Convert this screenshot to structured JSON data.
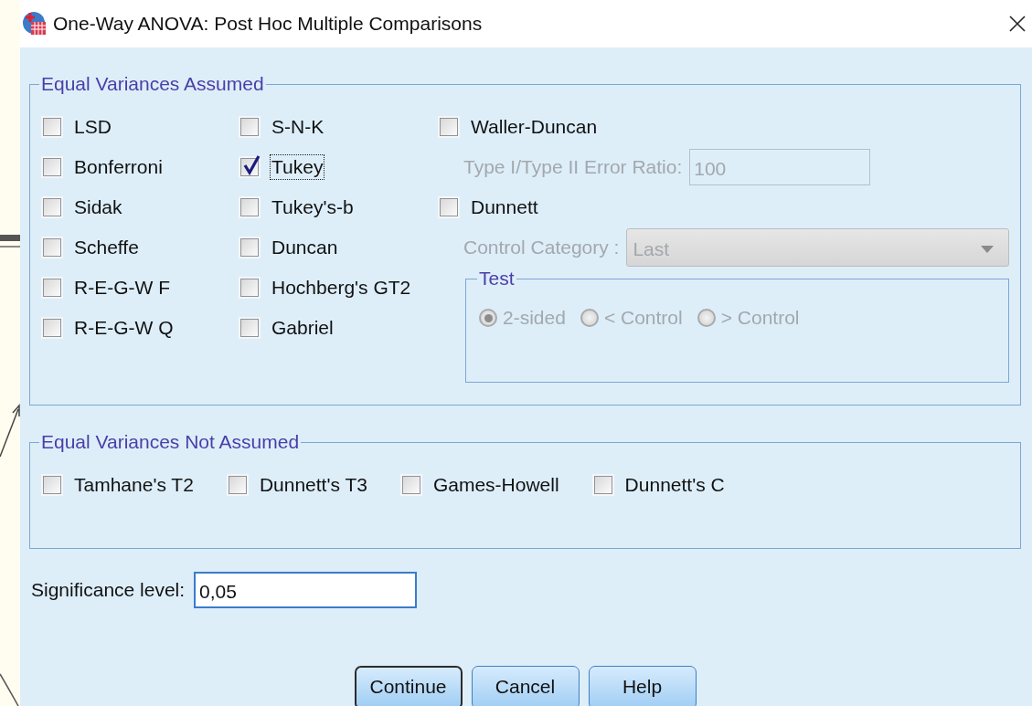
{
  "window": {
    "title": "One-Way ANOVA: Post Hoc Multiple Comparisons"
  },
  "equal_variances_assumed": {
    "title": "Equal Variances Assumed",
    "tests": [
      {
        "label": "LSD",
        "checked": false,
        "focused": false
      },
      {
        "label": "S-N-K",
        "checked": false,
        "focused": false
      },
      {
        "label": "Bonferroni",
        "checked": false,
        "focused": false
      },
      {
        "label": "Tukey",
        "checked": true,
        "focused": true
      },
      {
        "label": "Sidak",
        "checked": false,
        "focused": false
      },
      {
        "label": "Tukey's-b",
        "checked": false,
        "focused": false
      },
      {
        "label": "Scheffe",
        "checked": false,
        "focused": false
      },
      {
        "label": "Duncan",
        "checked": false,
        "focused": false
      },
      {
        "label": "R-E-G-W F",
        "checked": false,
        "focused": false
      },
      {
        "label": "Hochberg's GT2",
        "checked": false,
        "focused": false
      },
      {
        "label": "R-E-G-W Q",
        "checked": false,
        "focused": false
      },
      {
        "label": "Gabriel",
        "checked": false,
        "focused": false
      }
    ],
    "waller_duncan": {
      "label": "Waller-Duncan",
      "checked": false
    },
    "error_ratio": {
      "label": "Type I/Type II Error Ratio:",
      "value": "100",
      "disabled": true
    },
    "dunnett": {
      "label": "Dunnett",
      "checked": false
    },
    "control_category": {
      "label": "Control Category :",
      "value": "Last",
      "disabled": true
    },
    "test": {
      "title": "Test",
      "disabled": true,
      "options": [
        {
          "label": "2-sided",
          "selected": true
        },
        {
          "label": "< Control",
          "selected": false
        },
        {
          "label": "> Control",
          "selected": false
        }
      ]
    }
  },
  "equal_variances_not_assumed": {
    "title": "Equal Variances Not Assumed",
    "tests": [
      {
        "label": "Tamhane's T2",
        "checked": false
      },
      {
        "label": "Dunnett's T3",
        "checked": false
      },
      {
        "label": "Games-Howell",
        "checked": false
      },
      {
        "label": "Dunnett's C",
        "checked": false
      }
    ]
  },
  "significance": {
    "label": "Significance level:",
    "value": "0,05"
  },
  "buttons": [
    {
      "label": "Continue",
      "default": true
    },
    {
      "label": "Cancel",
      "default": false
    },
    {
      "label": "Help",
      "default": false
    }
  ]
}
